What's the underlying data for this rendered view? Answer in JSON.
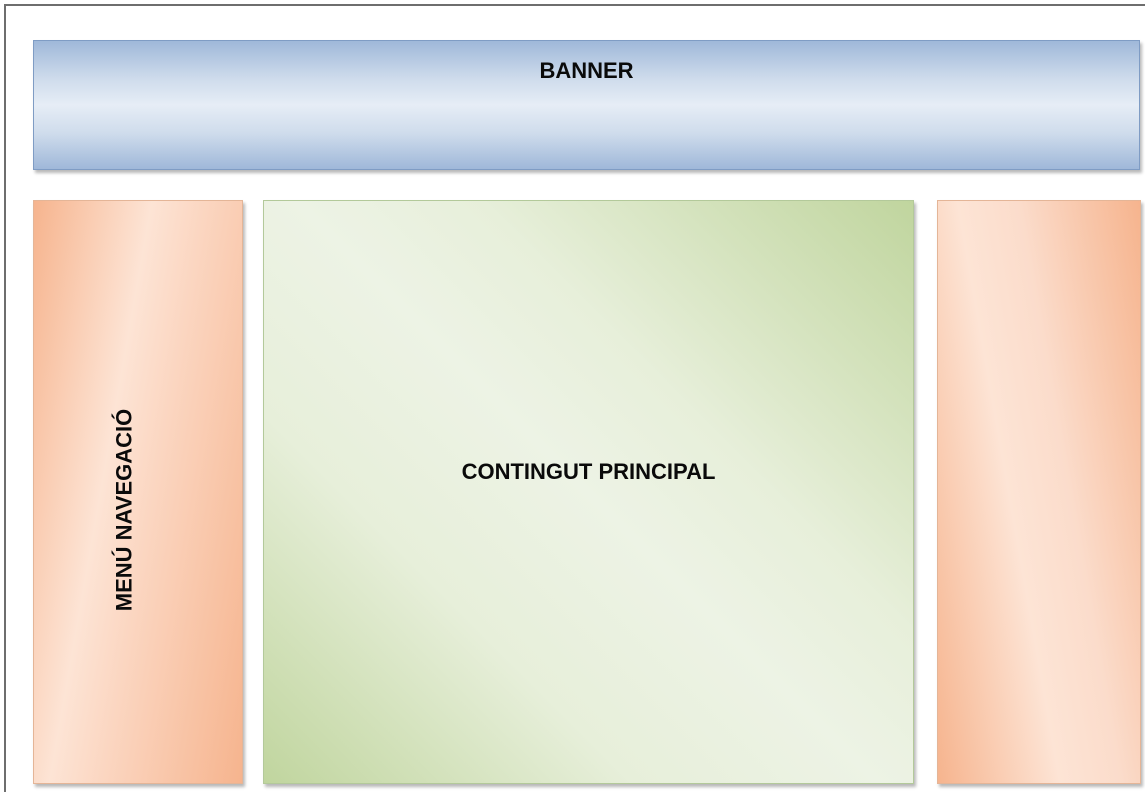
{
  "diagram": {
    "banner": {
      "label": "BANNER",
      "color": "#9fb8d9"
    },
    "navigation_menu": {
      "label": "MENÚ NAVEGACIÓ",
      "color": "#f6b48e"
    },
    "main_content": {
      "label": "CONTINGUT PRINCIPAL",
      "color": "#c0d59e"
    },
    "right_sidebar": {
      "label": "",
      "color": "#f6b48e"
    }
  }
}
